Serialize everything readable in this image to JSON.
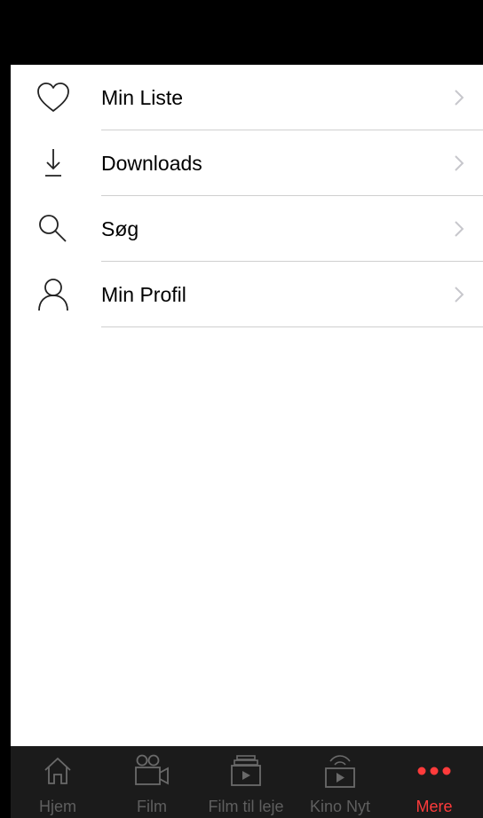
{
  "menu": {
    "items": [
      {
        "label": "Min Liste",
        "icon": "heart-icon"
      },
      {
        "label": "Downloads",
        "icon": "download-icon"
      },
      {
        "label": "Søg",
        "icon": "search-icon"
      },
      {
        "label": "Min Profil",
        "icon": "person-icon"
      }
    ]
  },
  "tabbar": {
    "tabs": [
      {
        "label": "Hjem",
        "icon": "home-icon",
        "active": false
      },
      {
        "label": "Film",
        "icon": "film-camera-icon",
        "active": false
      },
      {
        "label": "Film til leje",
        "icon": "rental-film-icon",
        "active": false
      },
      {
        "label": "Kino Nyt",
        "icon": "cinema-news-icon",
        "active": false
      },
      {
        "label": "Mere",
        "icon": "more-dots-icon",
        "active": true
      }
    ]
  },
  "colors": {
    "header": "#000000",
    "background": "#ffffff",
    "tabbar": "#1b1b1b",
    "tab_inactive": "#5f5f5f",
    "tab_active": "#ff3b3b",
    "chevron": "#c7c7cc",
    "divider": "#cfcfcf"
  }
}
